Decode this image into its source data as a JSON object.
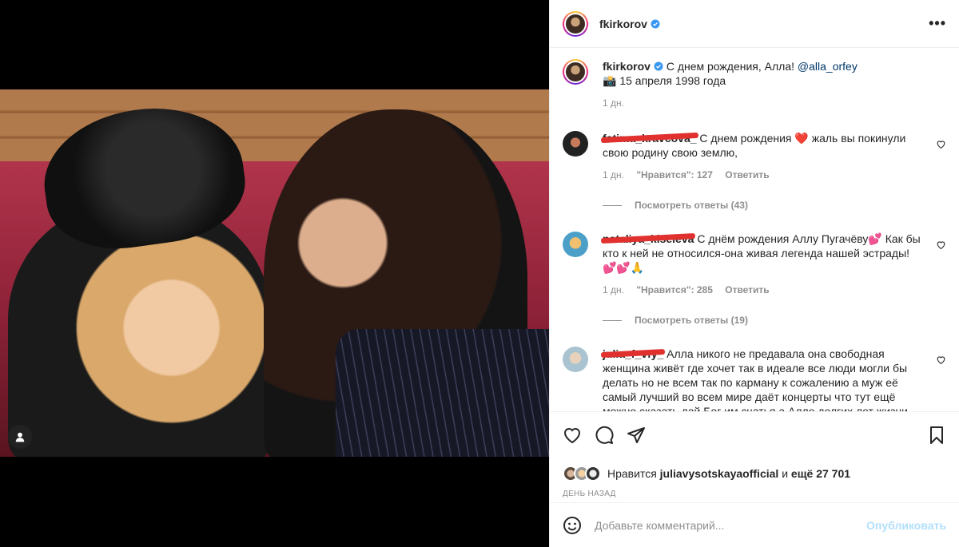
{
  "post": {
    "username": "fkirkorov",
    "more_label": "•••"
  },
  "caption": {
    "username": "fkirkorov",
    "text": "С днем рождения, Алла!",
    "mention": "@alla_orfey",
    "line2": "📸 15 апреля 1998 года",
    "time": "1 дн."
  },
  "comments": [
    {
      "username": "fatima_kravcova_",
      "text": "С днем рождения ❤️ жаль вы покинули свою родину свою землю,",
      "time": "1 дн.",
      "likes": "\"Нравится\": 127",
      "reply": "Ответить",
      "view_replies": "Посмотреть ответы (43)"
    },
    {
      "username": "nataliya_kiseleva",
      "text": "С днём рождения Аллу Пугачёву💕 Как бы кто к ней не относился-она живая легенда нашей эстрады! 💕💕🙏",
      "time": "1 дн.",
      "likes": "\"Нравится\": 285",
      "reply": "Ответить",
      "view_replies": "Посмотреть ответы (19)"
    },
    {
      "username": "julia_f_vfy_",
      "text": "Алла никого не предавала она свободная женщина живёт где хочет так в идеале все люди могли бы делать но не всем так по карману к сожалению а муж её самый лучший во всем мире даёт концерты что тут ещё можно сказать дай Бог им счатья а Алле долгих лет жизни"
    }
  ],
  "likes": {
    "prefix": "Нравится",
    "user": "juliavysotskayaofficial",
    "middle": "и",
    "rest": "ещё 27 701"
  },
  "time_ago": "ДЕНЬ НАЗАД",
  "add_comment": {
    "placeholder": "Добавьте комментарий...",
    "publish": "Опубликовать"
  },
  "icons": {
    "like": "heart-icon",
    "comment": "comment-icon",
    "share": "paper-plane-icon",
    "save": "bookmark-icon",
    "emoji": "emoji-icon",
    "tag": "person-tag-icon",
    "verified": "verified-badge-icon"
  },
  "colors": {
    "verified": "#3897f0",
    "link": "#00376b",
    "publish_disabled": "#b2dffc",
    "redaction": "#e0312f"
  }
}
